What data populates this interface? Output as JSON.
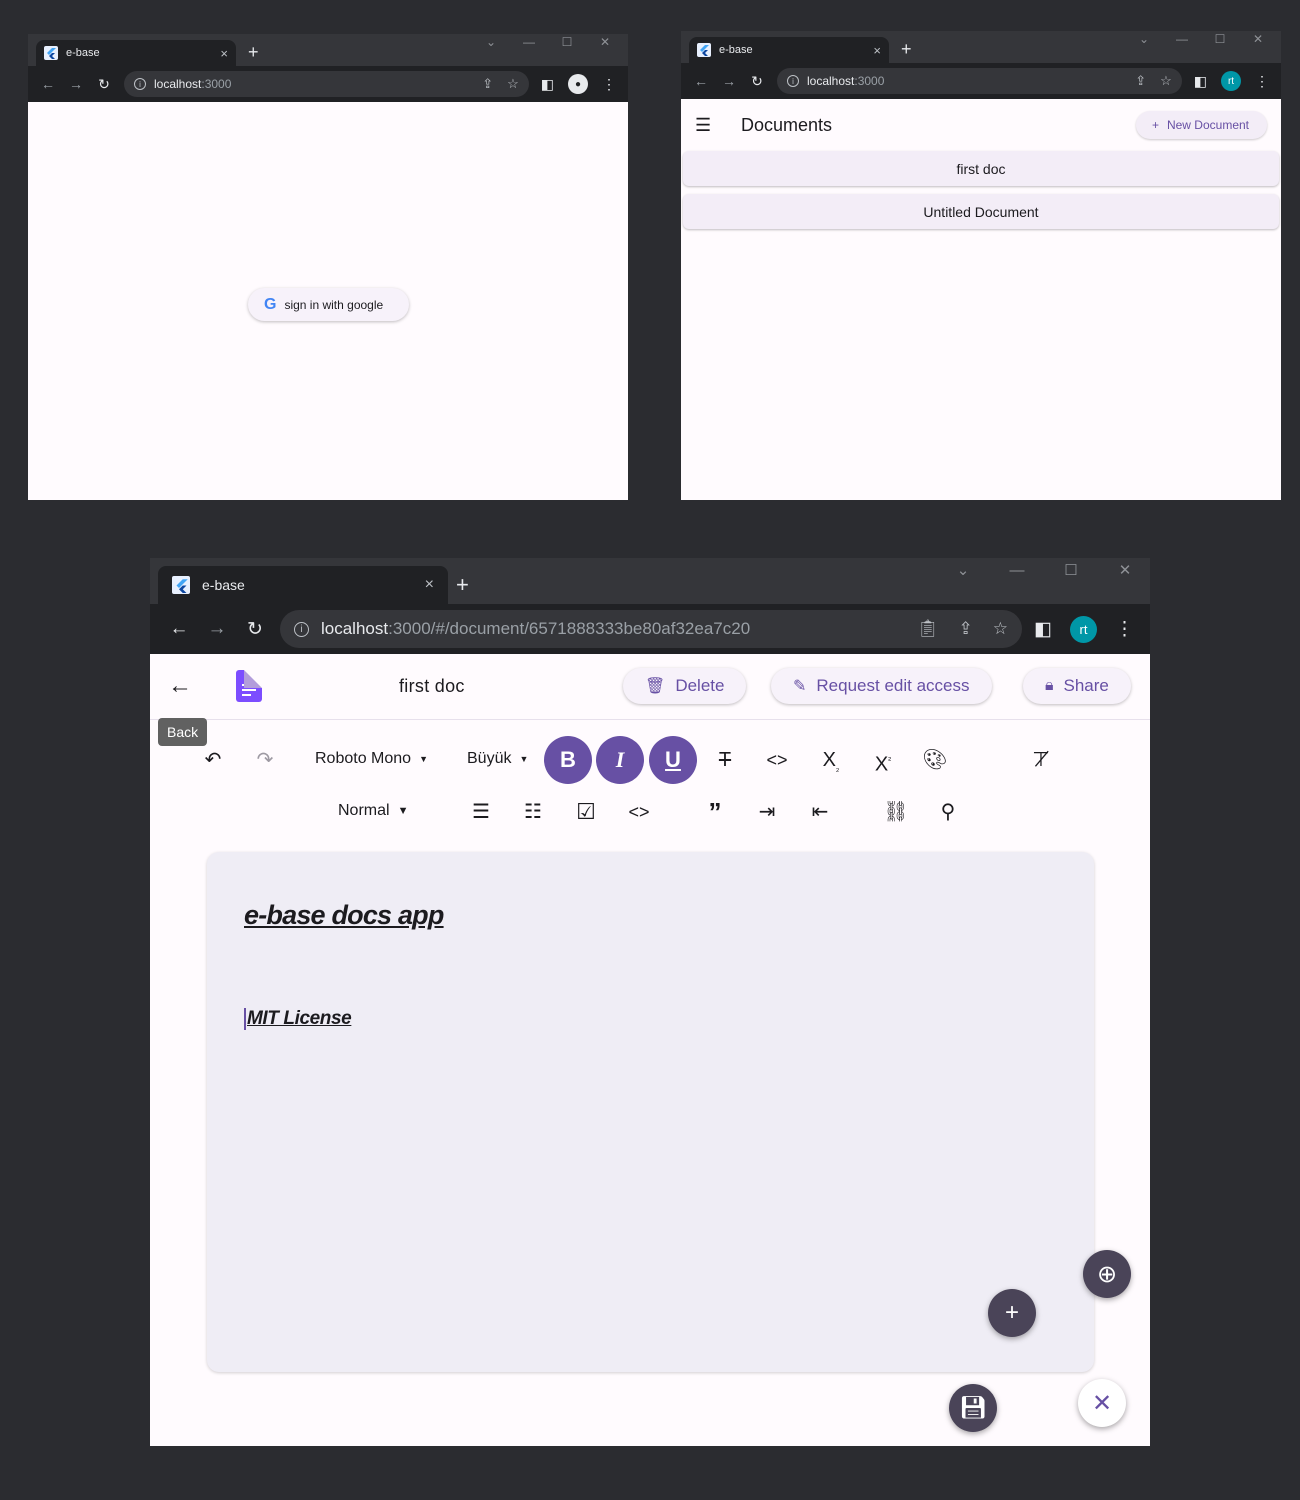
{
  "browser": {
    "tab_title": "e-base",
    "tab_close": "×",
    "new_tab": "+",
    "url_host": "localhost",
    "url_port": ":3000",
    "url_full_host": "localhost",
    "url_full_rest": ":3000/#/document/6571888333be80af32ea7c20",
    "avatar_initials": "rt"
  },
  "login_screen": {
    "google_button_label": "sign in with google"
  },
  "documents_screen": {
    "title": "Documents",
    "new_document_label": "New Document",
    "documents": [
      "first doc",
      "Untitled Document"
    ]
  },
  "editor_screen": {
    "doc_title": "first doc",
    "delete_label": "Delete",
    "request_edit_label": "Request edit access",
    "share_label": "Share",
    "back_tooltip": "Back",
    "font_family": "Roboto Mono",
    "font_size": "Büyük",
    "heading_style": "Normal",
    "content": {
      "heading": "e-base docs app",
      "line2": "MIT License"
    }
  },
  "colors": {
    "primary": "#6750a4",
    "surface": "#fffbfe",
    "editor_bg": "#efedf5",
    "chrome_dark": "#202124",
    "avatar": "#0097a7"
  }
}
